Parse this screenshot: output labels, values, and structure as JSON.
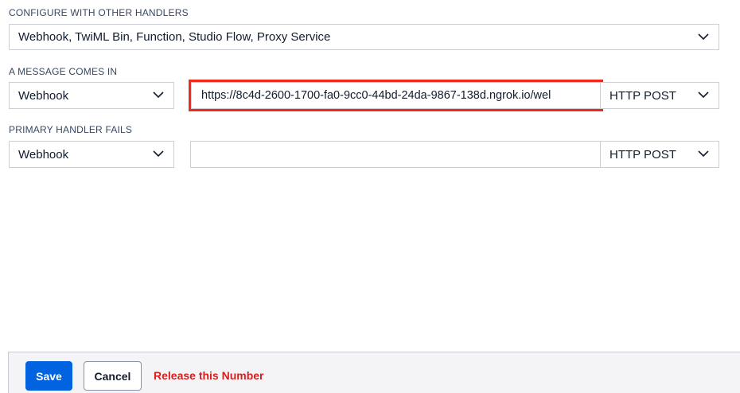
{
  "other_handlers": {
    "label": "CONFIGURE WITH OTHER HANDLERS",
    "selected": "Webhook, TwiML Bin, Function, Studio Flow, Proxy Service"
  },
  "message_comes_in": {
    "label": "A MESSAGE COMES IN",
    "handler_type": "Webhook",
    "url_value": "https://8c4d-2600-1700-fa0-9cc0-44bd-24da-9867-138d.ngrok.io/wel",
    "method": "HTTP POST"
  },
  "primary_handler_fails": {
    "label": "PRIMARY HANDLER FAILS",
    "handler_type": "Webhook",
    "url_value": "",
    "method": "HTTP POST"
  },
  "footer": {
    "save_label": "Save",
    "cancel_label": "Cancel",
    "release_label": "Release this Number"
  },
  "colors": {
    "primary_button": "#0263e0",
    "destructive_link": "#d61f1f",
    "highlight_border": "#f0291a"
  },
  "icons": {
    "dropdown": "chevron-down-icon"
  }
}
